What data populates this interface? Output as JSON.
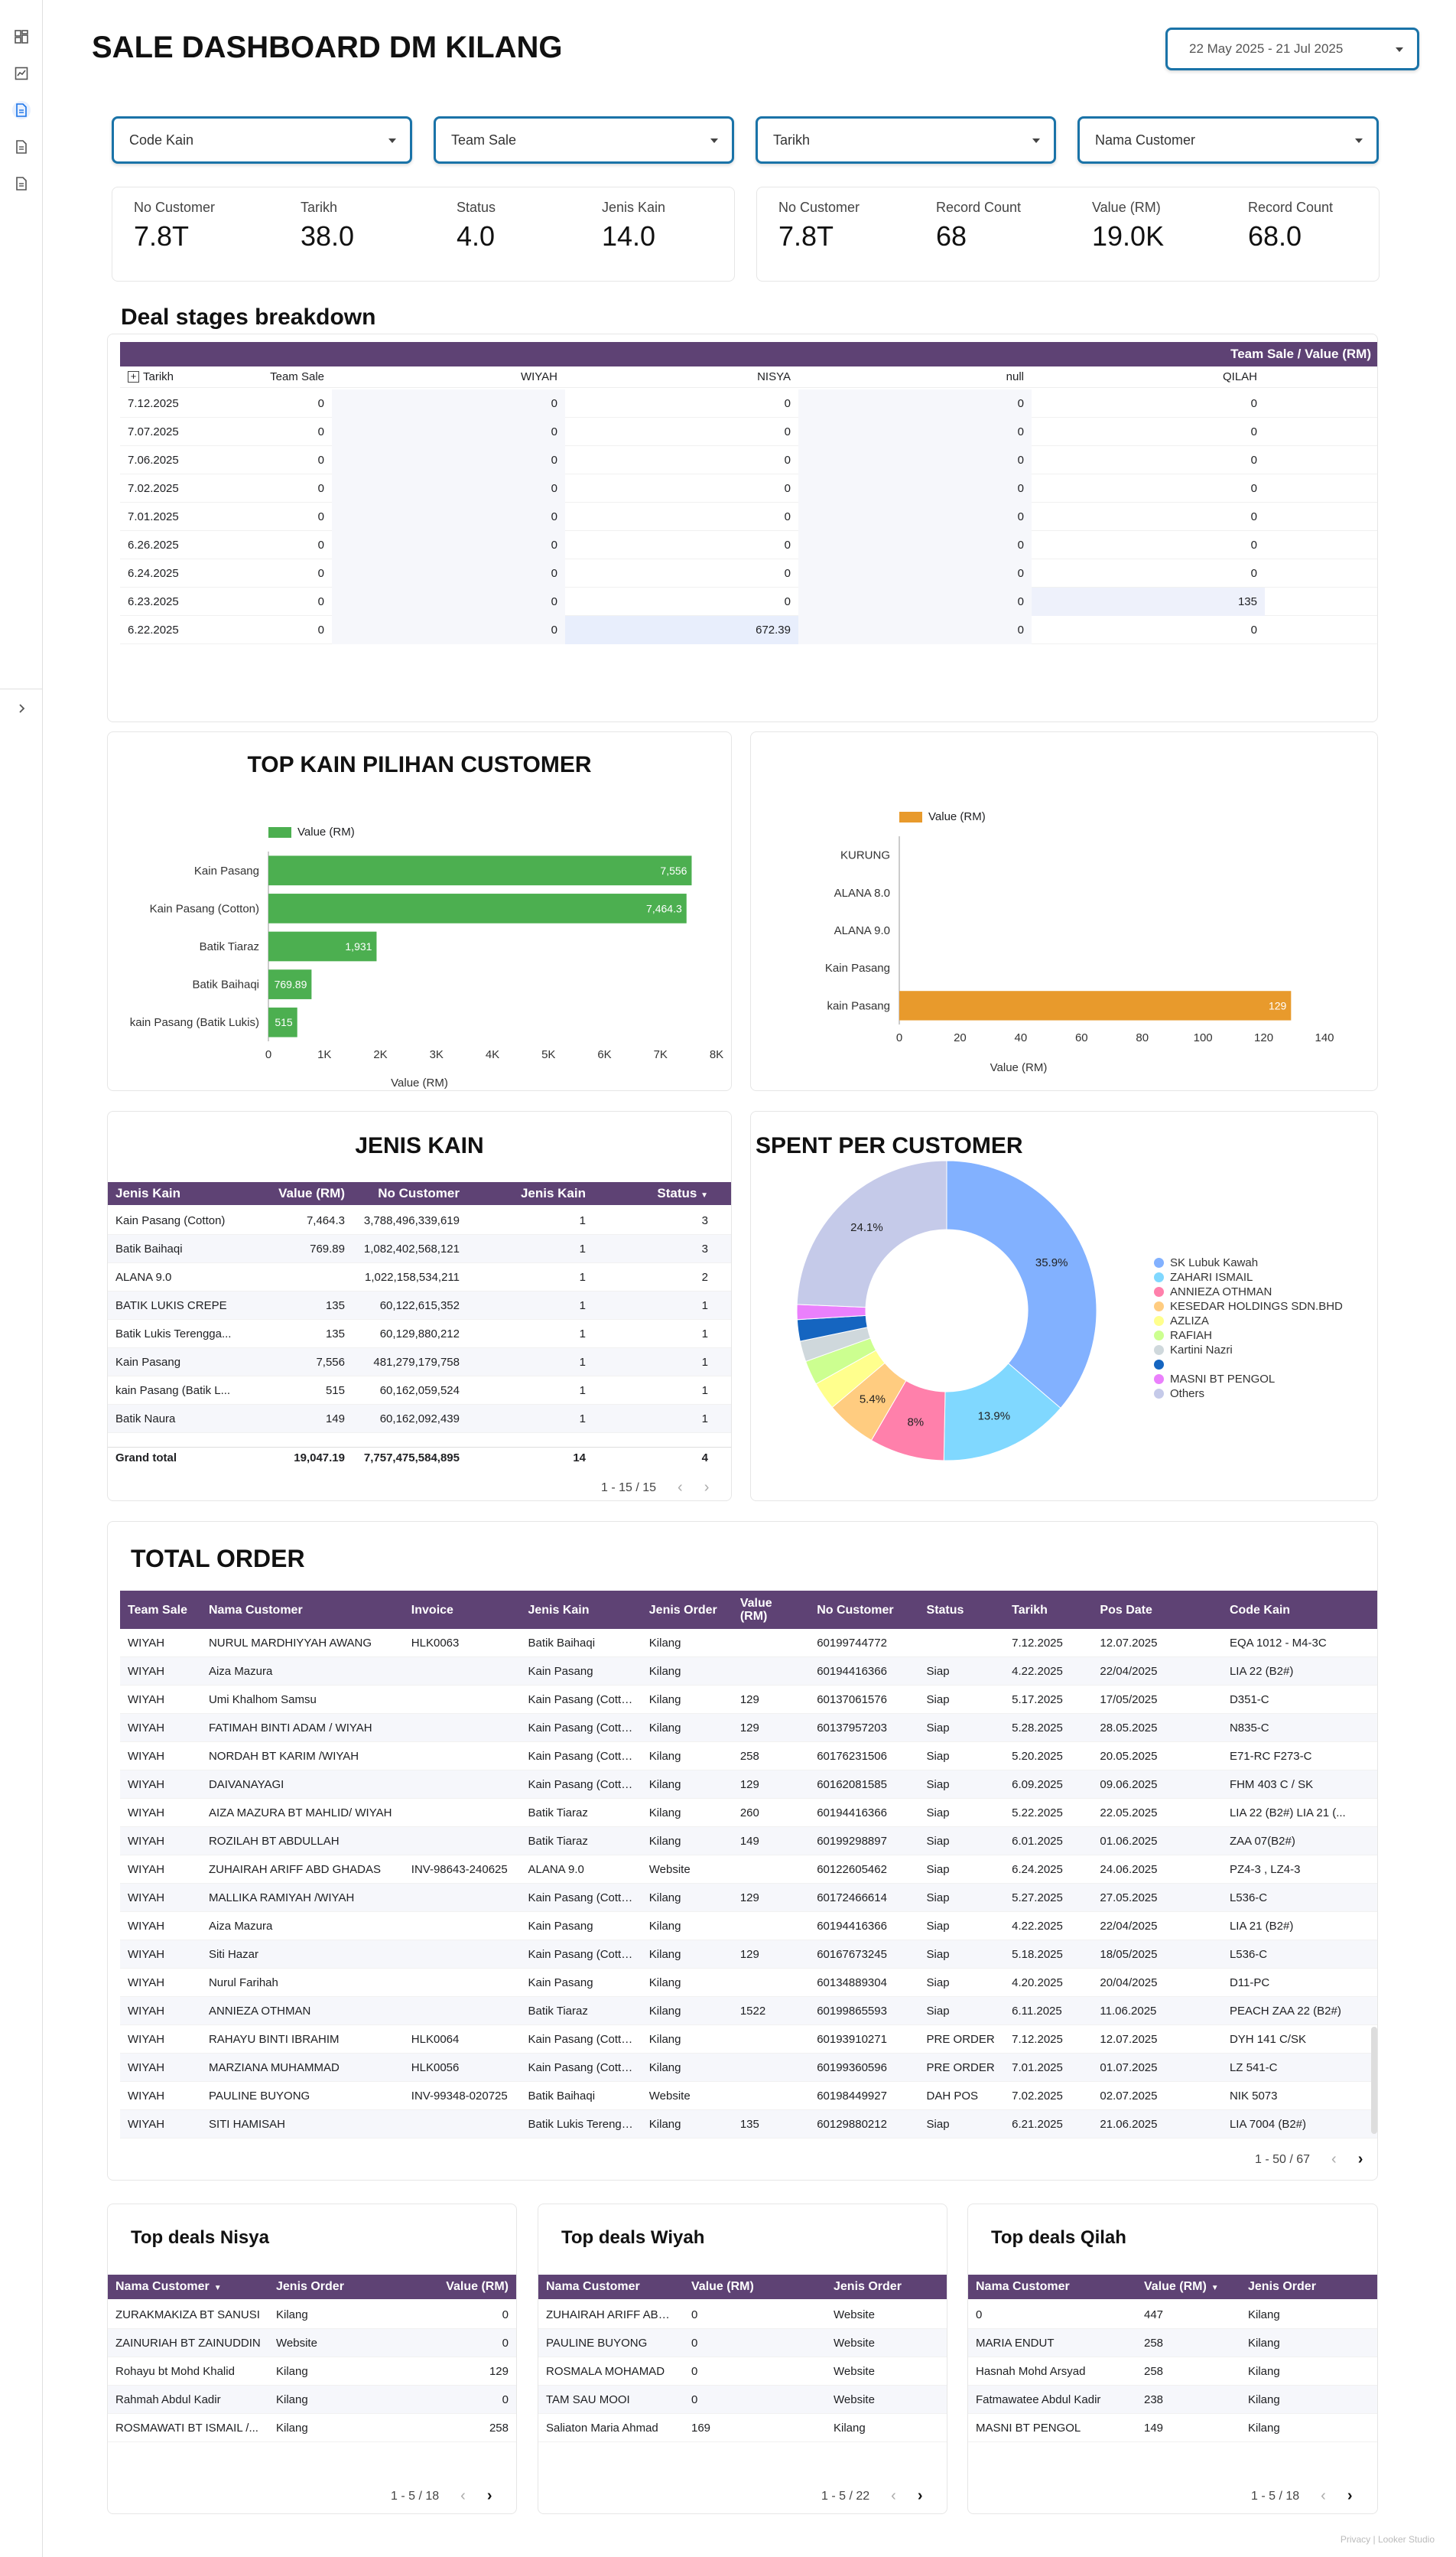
{
  "header": {
    "title": "SALE DASHBOARD DM KILANG",
    "date_range": "22 May 2025 - 21 Jul 2025"
  },
  "sidebar": {
    "icons": [
      "dashboard-icon",
      "chart-icon",
      "page-icon-active",
      "page-icon",
      "page-icon"
    ],
    "expand": "chevron-right-icon"
  },
  "filters": [
    "Code Kain",
    "Team Sale",
    "Tarikh",
    "Nama Customer"
  ],
  "kpi_left": [
    {
      "label": "No Customer",
      "value": "7.8T"
    },
    {
      "label": "Tarikh",
      "value": "38.0"
    },
    {
      "label": "Status",
      "value": "4.0"
    },
    {
      "label": "Jenis Kain",
      "value": "14.0"
    }
  ],
  "kpi_right": [
    {
      "label": "No Customer",
      "value": "7.8T"
    },
    {
      "label": "Record Count",
      "value": "68"
    },
    {
      "label": "Value (RM)",
      "value": "19.0K"
    },
    {
      "label": "Record Count",
      "value": "68.0"
    }
  ],
  "deal_stages": {
    "title": "Deal stages breakdown",
    "top_header": "Team Sale / Value (RM)",
    "row_dim": "Tarikh",
    "columns": [
      "Team Sale",
      "WIYAH",
      "NISYA",
      "null",
      "QILAH"
    ],
    "rows": [
      [
        "7.12.2025",
        "0",
        "0",
        "0",
        "0",
        "0"
      ],
      [
        "7.07.2025",
        "0",
        "0",
        "0",
        "0",
        "0"
      ],
      [
        "7.06.2025",
        "0",
        "0",
        "0",
        "0",
        "0"
      ],
      [
        "7.02.2025",
        "0",
        "0",
        "0",
        "0",
        "0"
      ],
      [
        "7.01.2025",
        "0",
        "0",
        "0",
        "0",
        "0"
      ],
      [
        "6.26.2025",
        "0",
        "0",
        "0",
        "0",
        "0"
      ],
      [
        "6.24.2025",
        "0",
        "0",
        "0",
        "0",
        "0"
      ],
      [
        "6.23.2025",
        "0",
        "0",
        "0",
        "0",
        "135"
      ],
      [
        "6.22.2025",
        "0",
        "0",
        "672.39",
        "0",
        "0"
      ]
    ]
  },
  "top_kain_chart": {
    "title": "TOP KAIN PILIHAN CUSTOMER",
    "legend": "Value (RM)",
    "xlabel": "Value (RM)",
    "ticks": [
      "0",
      "1K",
      "2K",
      "3K",
      "4K",
      "5K",
      "6K",
      "7K",
      "8K"
    ]
  },
  "right_chart": {
    "legend": "Value (RM)",
    "xlabel": "Value (RM)",
    "ticks": [
      "0",
      "20",
      "40",
      "60",
      "80",
      "100",
      "120",
      "140"
    ]
  },
  "chart_data": [
    {
      "type": "bar",
      "orientation": "horizontal",
      "title": "TOP KAIN PILIHAN CUSTOMER",
      "categories": [
        "Kain Pasang",
        "Kain Pasang (Cotton)",
        "Batik Tiaraz",
        "Batik Baihaqi",
        "kain Pasang (Batik Lukis)"
      ],
      "values": [
        7556,
        7464.3,
        1931,
        769.89,
        515
      ],
      "labels": [
        "7,556",
        "7,464.3",
        "1,931",
        "769.89",
        "515"
      ],
      "series_name": "Value (RM)",
      "xlabel": "Value (RM)",
      "xlim": [
        0,
        8000
      ],
      "color": "#4caf50"
    },
    {
      "type": "bar",
      "orientation": "horizontal",
      "categories": [
        "KURUNG",
        "ALANA 8.0",
        "ALANA 9.0",
        "Kain Pasang",
        "kain Pasang"
      ],
      "values": [
        0,
        0,
        0,
        0,
        129
      ],
      "labels": [
        "",
        "",
        "",
        "",
        "129"
      ],
      "series_name": "Value (RM)",
      "xlabel": "Value (RM)",
      "xlim": [
        0,
        140
      ],
      "color": "#e89a2c"
    },
    {
      "type": "pie",
      "title": "SPENT PER CUSTOMER",
      "donut": true,
      "slices": [
        {
          "name": "SK Lubuk Kawah",
          "value": 35.9,
          "color": "#82b1ff"
        },
        {
          "name": "ZAHARI ISMAIL",
          "value": 13.9,
          "color": "#80d8ff"
        },
        {
          "name": "ANNIEZA OTHMAN",
          "value": 8.0,
          "color": "#ff80ab"
        },
        {
          "name": "KESEDAR HOLDINGS SDN.BHD",
          "value": 5.4,
          "color": "#ffcc80"
        },
        {
          "name": "AZLIZA",
          "value": 3.0,
          "color": "#ffff8d"
        },
        {
          "name": "RAFIAH",
          "value": 2.6,
          "color": "#ccff90"
        },
        {
          "name": "Kartini Nazri",
          "value": 2.2,
          "color": "#cfd8dc"
        },
        {
          "name": "",
          "value": 2.3,
          "color": "#1565c0"
        },
        {
          "name": "MASNI BT PENGOL",
          "value": 1.6,
          "color": "#ea80fc"
        },
        {
          "name": "Others",
          "value": 24.1,
          "color": "#c5cae9"
        }
      ],
      "labels": [
        "35.9%",
        "13.9%",
        "8%",
        "5.4%",
        "24.1%"
      ]
    }
  ],
  "jenis_kain": {
    "title": "JENIS KAIN",
    "columns": [
      "Jenis Kain",
      "Value (RM)",
      "No Customer",
      "Jenis Kain",
      "Status"
    ],
    "rows": [
      [
        "Kain Pasang (Cotton)",
        "7,464.3",
        "3,788,496,339,619",
        "1",
        "3"
      ],
      [
        "Batik Baihaqi",
        "769.89",
        "1,082,402,568,121",
        "1",
        "3"
      ],
      [
        "ALANA 9.0",
        "",
        "1,022,158,534,211",
        "1",
        "2"
      ],
      [
        "BATIK LUKIS CREPE",
        "135",
        "60,122,615,352",
        "1",
        "1"
      ],
      [
        "Batik Lukis Terengga...",
        "135",
        "60,129,880,212",
        "1",
        "1"
      ],
      [
        "Kain Pasang",
        "7,556",
        "481,279,179,758",
        "1",
        "1"
      ],
      [
        "kain Pasang (Batik L...",
        "515",
        "60,162,059,524",
        "1",
        "1"
      ],
      [
        "Batik Naura",
        "149",
        "60,162,092,439",
        "1",
        "1"
      ]
    ],
    "total": [
      "Grand total",
      "19,047.19",
      "7,757,475,584,895",
      "14",
      "4"
    ],
    "pager": "1 - 15 / 15"
  },
  "spent": {
    "title": "SPENT PER CUSTOMER"
  },
  "total_order": {
    "title": "TOTAL ORDER",
    "columns": [
      "Team Sale",
      "Nama Customer",
      "Invoice",
      "Jenis Kain",
      "Jenis Order",
      "Value (RM)",
      "No Customer",
      "Status",
      "Tarikh",
      "Pos Date",
      "Code Kain"
    ],
    "rows": [
      [
        "WIYAH",
        "NURUL MARDHIYYAH AWANG",
        "HLK0063",
        "Batik Baihaqi",
        "Kilang",
        "",
        "60199744772",
        "",
        "7.12.2025",
        "12.07.2025",
        "EQA 1012 - M4-3C"
      ],
      [
        "WIYAH",
        "Aiza Mazura",
        "",
        "Kain Pasang",
        "Kilang",
        "",
        "60194416366",
        "Siap",
        "4.22.2025",
        "22/04/2025",
        "LIA 22 (B2#)"
      ],
      [
        "WIYAH",
        "Umi Khalhom Samsu",
        "",
        "Kain Pasang (Cotto...",
        "Kilang",
        "129",
        "60137061576",
        "Siap",
        "5.17.2025",
        "17/05/2025",
        "D351-C"
      ],
      [
        "WIYAH",
        "FATIMAH BINTI ADAM / WIYAH",
        "",
        "Kain Pasang (Cotto...",
        "Kilang",
        "129",
        "60137957203",
        "Siap",
        "5.28.2025",
        "28.05.2025",
        "N835-C"
      ],
      [
        "WIYAH",
        "NORDAH BT KARIM /WIYAH",
        "",
        "Kain Pasang (Cotto...",
        "Kilang",
        "258",
        "60176231506",
        "Siap",
        "5.20.2025",
        "20.05.2025",
        "E71-RC F273-C"
      ],
      [
        "WIYAH",
        "DAIVANAYAGI",
        "",
        "Kain Pasang (Cotto...",
        "Kilang",
        "129",
        "60162081585",
        "Siap",
        "6.09.2025",
        "09.06.2025",
        "FHM 403 C / SK"
      ],
      [
        "WIYAH",
        "AIZA MAZURA BT MAHLID/ WIYAH",
        "",
        "Batik Tiaraz",
        "Kilang",
        "260",
        "60194416366",
        "Siap",
        "5.22.2025",
        "22.05.2025",
        "LIA 22 (B2#) LIA 21 (..."
      ],
      [
        "WIYAH",
        "ROZILAH BT ABDULLAH",
        "",
        "Batik Tiaraz",
        "Kilang",
        "149",
        "60199298897",
        "Siap",
        "6.01.2025",
        "01.06.2025",
        "ZAA 07(B2#)"
      ],
      [
        "WIYAH",
        "ZUHAIRAH ARIFF ABD GHADAS",
        "INV-98643-240625",
        "ALANA 9.0",
        "Website",
        "",
        "60122605462",
        "Siap",
        "6.24.2025",
        "24.06.2025",
        "PZ4-3 , LZ4-3"
      ],
      [
        "WIYAH",
        "MALLIKA RAMIYAH /WIYAH",
        "",
        "Kain Pasang (Cotto...",
        "Kilang",
        "129",
        "60172466614",
        "Siap",
        "5.27.2025",
        "27.05.2025",
        "L536-C"
      ],
      [
        "WIYAH",
        "Aiza Mazura",
        "",
        "Kain Pasang",
        "Kilang",
        "",
        "60194416366",
        "Siap",
        "4.22.2025",
        "22/04/2025",
        "LIA 21 (B2#)"
      ],
      [
        "WIYAH",
        "Siti Hazar",
        "",
        "Kain Pasang (Cotto...",
        "Kilang",
        "129",
        "60167673245",
        "Siap",
        "5.18.2025",
        "18/05/2025",
        "L536-C"
      ],
      [
        "WIYAH",
        "Nurul Farihah",
        "",
        "Kain Pasang",
        "Kilang",
        "",
        "60134889304",
        "Siap",
        "4.20.2025",
        "20/04/2025",
        "D11-PC"
      ],
      [
        "WIYAH",
        "ANNIEZA OTHMAN",
        "",
        "Batik Tiaraz",
        "Kilang",
        "1522",
        "60199865593",
        "Siap",
        "6.11.2025",
        "11.06.2025",
        "PEACH ZAA 22 (B2#)"
      ],
      [
        "WIYAH",
        "RAHAYU BINTI IBRAHIM",
        "HLK0064",
        "Kain Pasang (Cotto...",
        "Kilang",
        "",
        "60193910271",
        "PRE ORDER",
        "7.12.2025",
        "12.07.2025",
        "DYH 141 C/SK"
      ],
      [
        "WIYAH",
        "MARZIANA MUHAMMAD",
        "HLK0056",
        "Kain Pasang (Cotto...",
        "Kilang",
        "",
        "60199360596",
        "PRE ORDER",
        "7.01.2025",
        "01.07.2025",
        "LZ 541-C"
      ],
      [
        "WIYAH",
        "PAULINE BUYONG",
        "INV-99348-020725",
        "Batik Baihaqi",
        "Website",
        "",
        "60198449927",
        "DAH POS",
        "7.02.2025",
        "02.07.2025",
        "NIK 5073"
      ],
      [
        "WIYAH",
        "SITI HAMISAH",
        "",
        "Batik Lukis Terengg...",
        "Kilang",
        "135",
        "60129880212",
        "Siap",
        "6.21.2025",
        "21.06.2025",
        "LIA 7004 (B2#)"
      ]
    ],
    "pager": "1 - 50 / 67"
  },
  "top_nisya": {
    "title": "Top deals Nisya",
    "columns": [
      "Nama Customer",
      "Jenis Order",
      "Value (RM)"
    ],
    "rows": [
      [
        "ZURAKMAKIZA BT SANUSI",
        "Kilang",
        "0"
      ],
      [
        "ZAINURIAH BT ZAINUDDIN",
        "Website",
        "0"
      ],
      [
        "Rohayu bt Mohd Khalid",
        "Kilang",
        "129"
      ],
      [
        "Rahmah Abdul Kadir",
        "Kilang",
        "0"
      ],
      [
        "ROSMAWATI BT ISMAIL /...",
        "Kilang",
        "258"
      ]
    ],
    "pager": "1 - 5 / 18"
  },
  "top_wiyah": {
    "title": "Top deals Wiyah",
    "columns": [
      "Nama Customer",
      "Value (RM)",
      "Jenis Order"
    ],
    "rows": [
      [
        "ZUHAIRAH ARIFF ABD ...",
        "0",
        "Website"
      ],
      [
        "PAULINE BUYONG",
        "0",
        "Website"
      ],
      [
        "ROSMALA MOHAMAD",
        "0",
        "Website"
      ],
      [
        "TAM SAU MOOI",
        "0",
        "Website"
      ],
      [
        "Saliaton Maria Ahmad",
        "169",
        "Kilang"
      ]
    ],
    "pager": "1 - 5 / 22"
  },
  "top_qilah": {
    "title": "Top deals Qilah",
    "columns": [
      "Nama Customer",
      "Value (RM)",
      "Jenis Order"
    ],
    "rows": [
      [
        "0",
        "447",
        "Kilang"
      ],
      [
        "MARIA ENDUT",
        "258",
        "Kilang"
      ],
      [
        "Hasnah Mohd Arsyad",
        "258",
        "Kilang"
      ],
      [
        "Fatmawatee Abdul Kadir",
        "238",
        "Kilang"
      ],
      [
        "MASNI BT PENGOL",
        "149",
        "Kilang"
      ]
    ],
    "pager": "1 - 5 / 18"
  },
  "footer": "Privacy | Looker Studio"
}
